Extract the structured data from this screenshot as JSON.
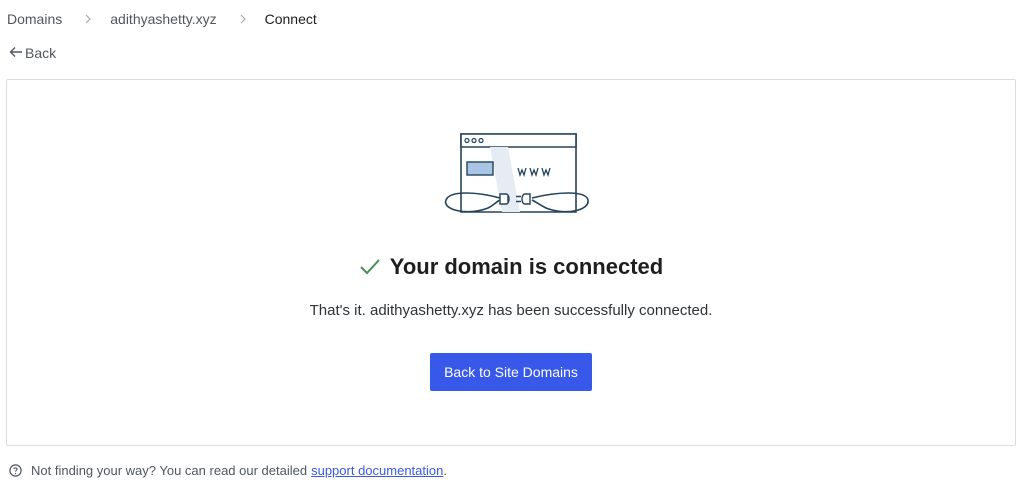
{
  "breadcrumb": {
    "items": [
      "Domains",
      "adithyashetty.xyz",
      "Connect"
    ]
  },
  "back": {
    "label": "Back"
  },
  "illustration": {
    "label": "www"
  },
  "status": {
    "title": "Your domain is connected",
    "description": "That's it. adithyashetty.xyz has been successfully connected.",
    "check_color": "#4a8b57"
  },
  "actions": {
    "primary_label": "Back to Site Domains",
    "primary_color": "#3858e9"
  },
  "footer": {
    "text": "Not finding your way? You can read our detailed",
    "link_text": "support documentation",
    "suffix": "."
  },
  "icons": [
    "chevron-right-icon",
    "arrow-left-icon",
    "checkmark-icon",
    "help-circle-icon",
    "browser-plug-illustration"
  ]
}
